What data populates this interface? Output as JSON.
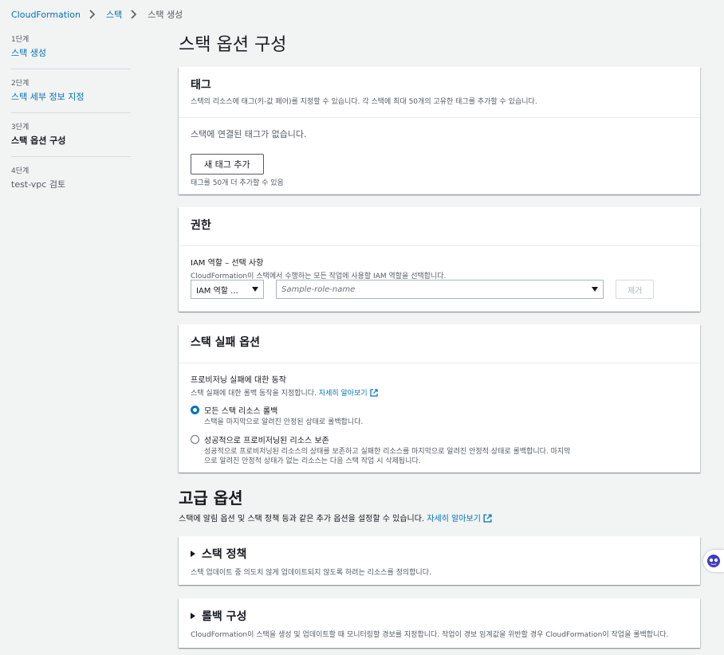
{
  "breadcrumb": [
    "CloudFormation",
    "스택",
    "스택 생성"
  ],
  "steps": [
    {
      "num": "1단계",
      "label": "스택 생성"
    },
    {
      "num": "2단계",
      "label": "스택 세부 정보 지정"
    },
    {
      "num": "3단계",
      "label": "스택 옵션 구성"
    },
    {
      "num": "4단계",
      "label": "test-vpc 검토"
    }
  ],
  "page_title": "스택 옵션 구성",
  "tags": {
    "title": "태그",
    "desc": "스택의 리소스에 태그(키-값 페어)를 지정할 수 있습니다. 각 스택에 최대 50개의 고유한 태그를 추가할 수 있습니다.",
    "empty": "스택에 연결된 태그가 없습니다.",
    "add_button": "새 태그 추가",
    "remaining": "태그를 50개 더 추가할 수 있음"
  },
  "permissions": {
    "title": "권한",
    "iam_label": "IAM 역할 – 선택 사항",
    "iam_desc": "CloudFormation이 스택에서 수행하는 모든 작업에 사용할 IAM 역할을 선택합니다.",
    "type_select": "IAM 역할 ...",
    "role_placeholder": "Sample-role-name",
    "remove_button": "제거"
  },
  "failure": {
    "title": "스택 실패 옵션",
    "behavior_label": "프로비저닝 실패에 대한 동작",
    "behavior_desc": "스택 실패에 대한 롤백 동작을 지정합니다.",
    "learn_more": "자세히 알아보기",
    "options": [
      {
        "label": "모든 스택 리소스 롤백",
        "desc": "스택을 마지막으로 알려진 안정된 상태로 롤백합니다.",
        "checked": true
      },
      {
        "label": "성공적으로 프로비저닝된 리소스 보존",
        "desc": "성공적으로 프로비저닝된 리소스의 상태를 보존하고 실패한 리소스를 마지막으로 알려진 안정적 상태로 롤백합니다. 마지막으로 알려진 안정적 상태가 없는 리소스는 다음 스택 작업 시 삭제됩니다.",
        "checked": false
      }
    ]
  },
  "advanced": {
    "title": "고급 옵션",
    "desc": "스택에 알림 옵션 및 스택 정책 등과 같은 추가 옵션을 설정할 수 있습니다.",
    "learn_more": "자세히 알아보기",
    "sections": [
      {
        "title": "스택 정책",
        "desc": "스택 업데이트 중 의도치 않게 업데이트되지 않도록 하려는 리소스를 정의합니다."
      },
      {
        "title": "롤백 구성",
        "desc": "CloudFormation이 스택을 생성 및 업데이트할 때 모니터링할 경보를 지정합니다. 작업이 경보 임계값을 위반할 경우 CloudFormation이 작업을 롤백합니다."
      }
    ]
  },
  "colors": {
    "link": "#0073bb",
    "background": "#f2f3f3"
  }
}
